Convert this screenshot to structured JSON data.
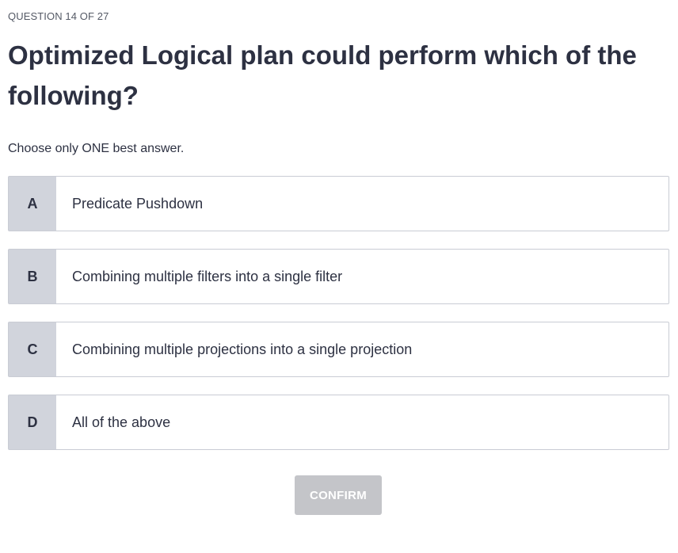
{
  "header": {
    "counter": "QUESTION 14 OF 27"
  },
  "question": {
    "title": "Optimized Logical plan could perform which of the following?",
    "instruction": "Choose only ONE best answer."
  },
  "options": [
    {
      "letter": "A",
      "text": "Predicate Pushdown"
    },
    {
      "letter": "B",
      "text": "Combining multiple filters into a single filter"
    },
    {
      "letter": "C",
      "text": "Combining multiple projections into a single projection"
    },
    {
      "letter": "D",
      "text": "All of the above"
    }
  ],
  "actions": {
    "confirm_label": "CONFIRM",
    "confirm_state": "disabled"
  },
  "colors": {
    "text": "#2d3142",
    "letter_bg": "#d1d4dc",
    "border": "#c9ccd4",
    "confirm_disabled_bg": "#c4c5c9"
  }
}
